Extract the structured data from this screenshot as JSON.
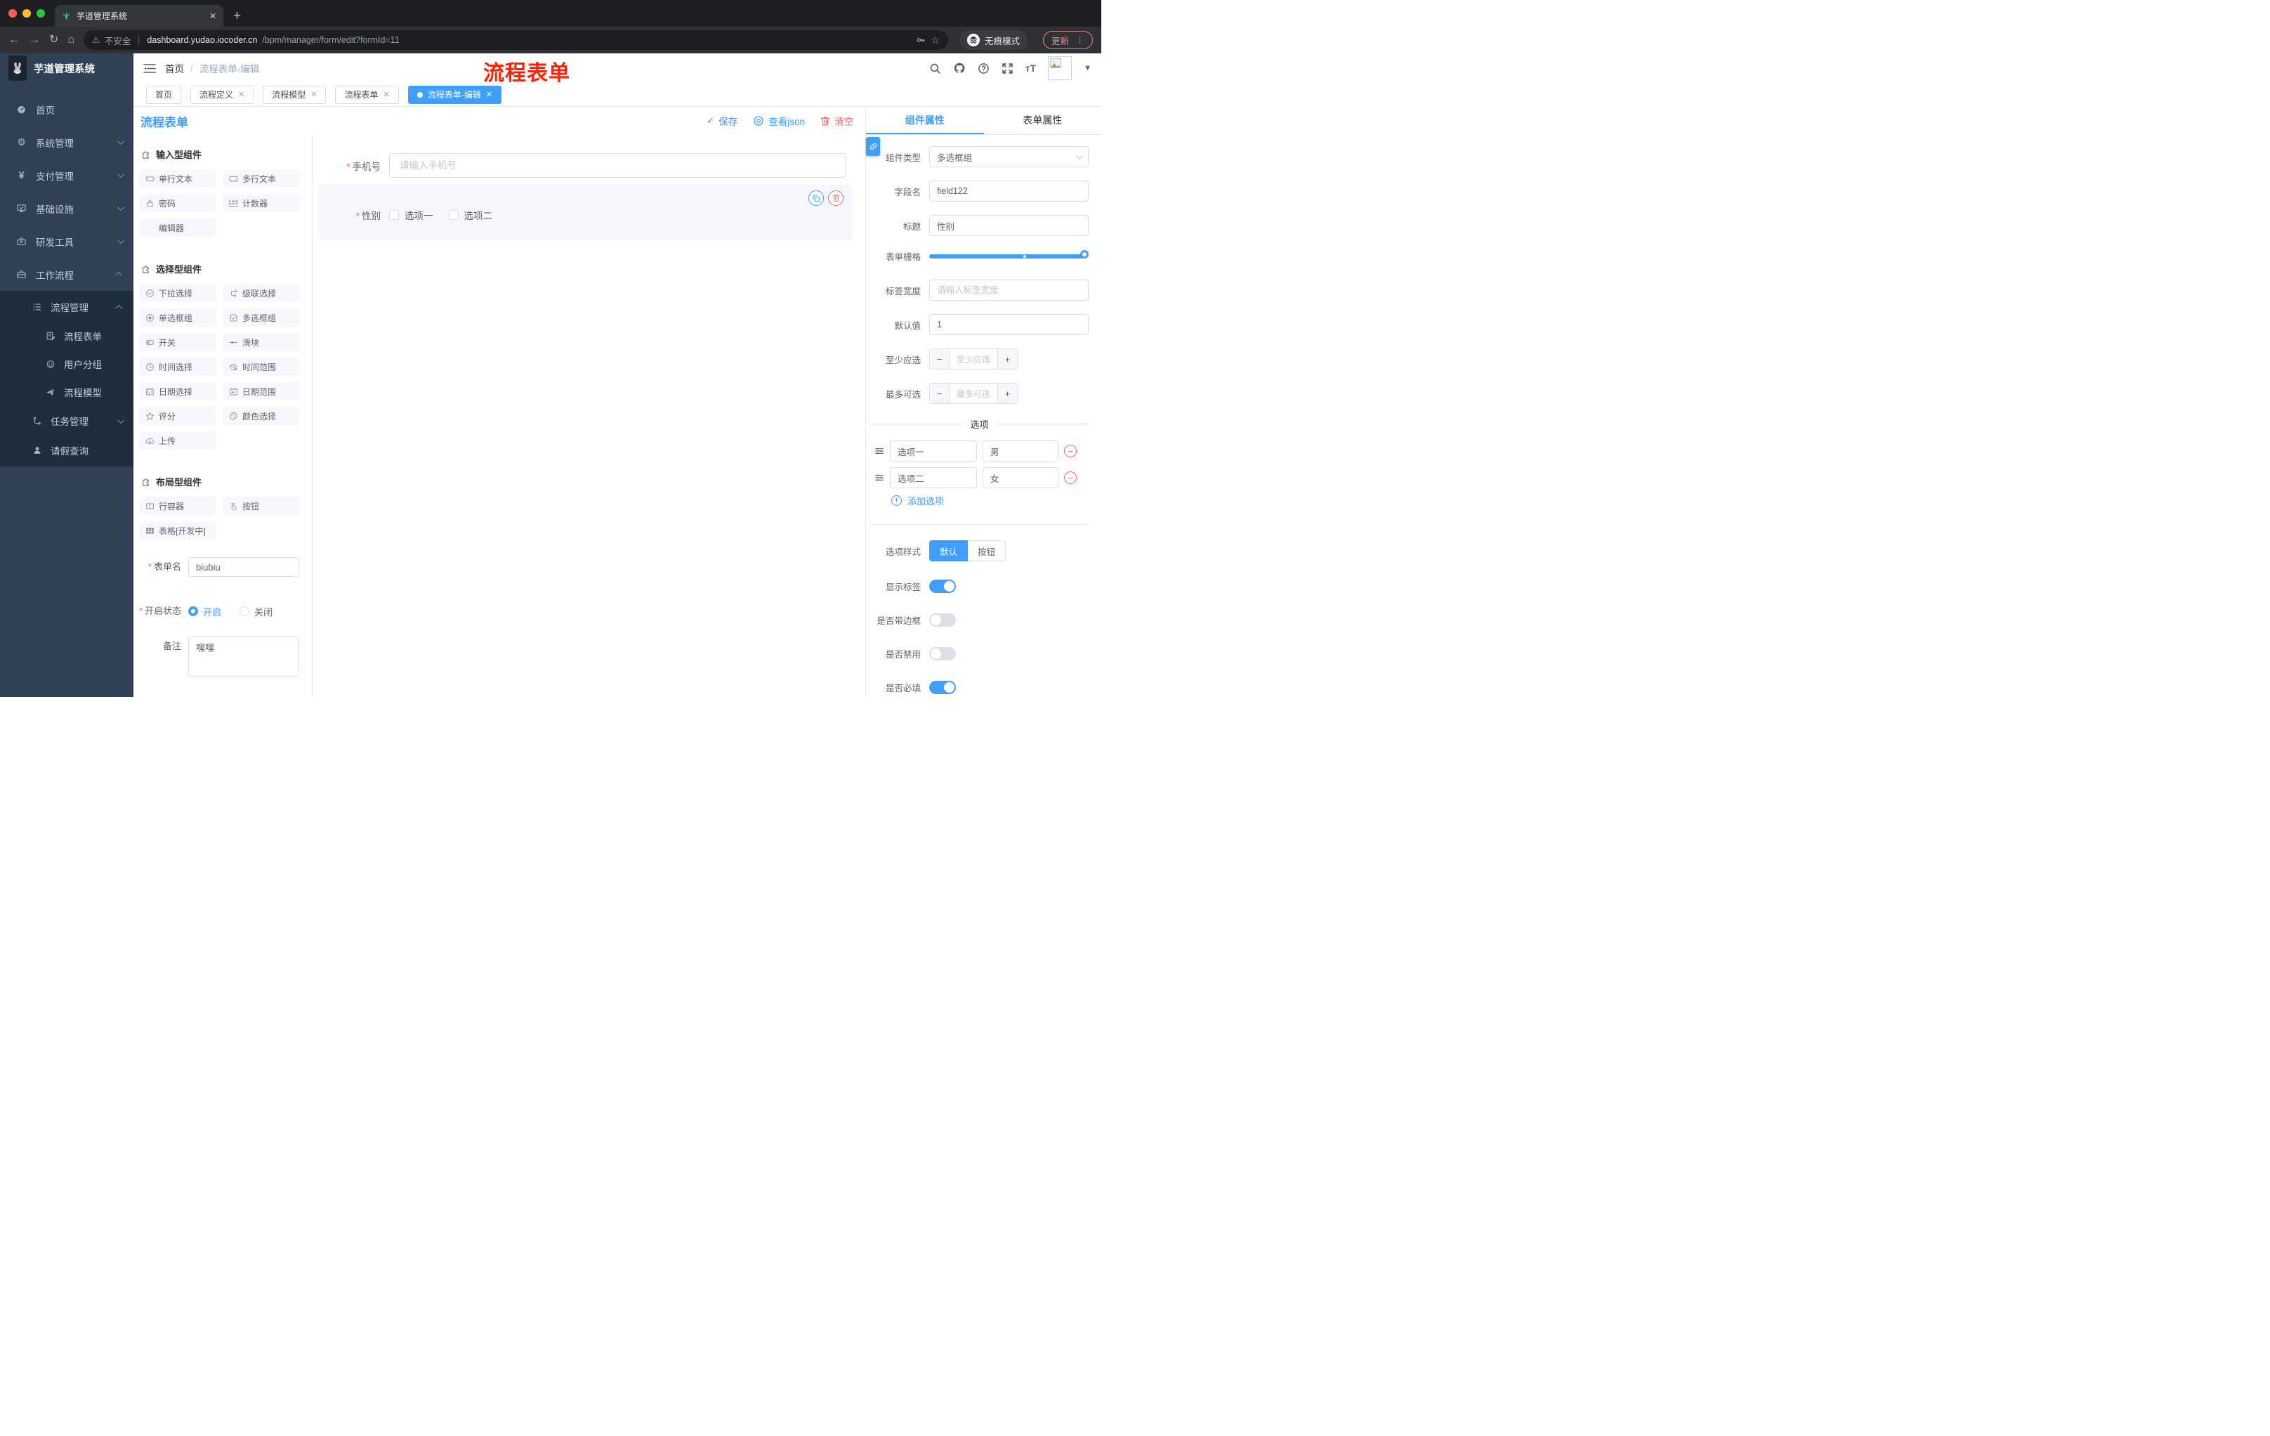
{
  "colors": {
    "primary": "#409EFF",
    "danger": "#F56C6C",
    "watermark_red": "#FF2200",
    "sidebar_bg": "#304156",
    "sidebar_submenu_bg": "#1F2D3D",
    "chrome_dark": "#1E1F22"
  },
  "browser": {
    "tab_title": "芋道管理系统",
    "security": "不安全",
    "domain": "dashboard.yudao.iocoder.cn",
    "path": "/bpm/manager/form/edit?formId=11",
    "incognito": "无痕模式",
    "update": "更新"
  },
  "brand": {
    "title": "芋道管理系统"
  },
  "breadcrumb": {
    "home": "首页",
    "sep": "/",
    "current": "流程表单-编辑"
  },
  "watermark": {
    "text": "流程表单"
  },
  "sidebar": {
    "items": [
      {
        "label": "首页"
      },
      {
        "label": "系统管理"
      },
      {
        "label": "支付管理"
      },
      {
        "label": "基础设施"
      },
      {
        "label": "研发工具"
      },
      {
        "label": "工作流程"
      }
    ],
    "sub": {
      "manage": "流程管理",
      "form": "流程表单",
      "usergroup": "用户分组",
      "model": "流程模型",
      "task": "任务管理",
      "leave": "请假查询"
    }
  },
  "pagetabs": {
    "items": [
      {
        "label": "首页"
      },
      {
        "label": "流程定义"
      },
      {
        "label": "流程模型"
      },
      {
        "label": "流程表单"
      },
      {
        "label": "流程表单-编辑"
      }
    ]
  },
  "area": {
    "title": "流程表单",
    "save": "保存",
    "viewjson": "查看json",
    "clear": "清空"
  },
  "panel": {
    "sections": [
      {
        "title": "输入型组件"
      },
      {
        "title": "选择型组件"
      },
      {
        "title": "布局型组件"
      }
    ],
    "input_items": [
      {
        "label": "单行文本"
      },
      {
        "label": "多行文本"
      },
      {
        "label": "密码"
      },
      {
        "label": "计数器"
      },
      {
        "label": "编辑器"
      }
    ],
    "select_items": [
      {
        "label": "下拉选择"
      },
      {
        "label": "级联选择"
      },
      {
        "label": "单选框组"
      },
      {
        "label": "多选框组"
      },
      {
        "label": "开关"
      },
      {
        "label": "滑块"
      },
      {
        "label": "时间选择"
      },
      {
        "label": "时间范围"
      },
      {
        "label": "日期选择"
      },
      {
        "label": "日期范围"
      },
      {
        "label": "评分"
      },
      {
        "label": "颜色选择"
      },
      {
        "label": "上传"
      }
    ],
    "layout_items": [
      {
        "label": "行容器"
      },
      {
        "label": "按钮"
      },
      {
        "label": "表格[开发中]"
      }
    ]
  },
  "meta": {
    "name_label": "表单名",
    "name_value": "biubiu",
    "status_label": "开启状态",
    "status_on": "开启",
    "status_off": "关闭",
    "remark_label": "备注",
    "remark_value": "嘿嘿"
  },
  "canvas": {
    "phone_label": "手机号",
    "phone_placeholder": "请输入手机号",
    "gender_label": "性别",
    "gender_opt1": "选项一",
    "gender_opt2": "选项二"
  },
  "props": {
    "tab_component": "组件属性",
    "tab_form": "表单属性",
    "type_label": "组件类型",
    "type_value": "多选框组",
    "field_label": "字段名",
    "field_value": "field122",
    "title_label": "标题",
    "title_value": "性别",
    "grid_label": "表单栅格",
    "labelw_label": "标签宽度",
    "labelw_placeholder": "请输入标签宽度",
    "default_label": "默认值",
    "default_value": "1",
    "min_label": "至少应选",
    "min_placeholder": "至少应选",
    "max_label": "最多可选",
    "max_placeholder": "最多可选",
    "options_title": "选项",
    "options": [
      {
        "label": "选项一",
        "value": "男"
      },
      {
        "label": "选项二",
        "value": "女"
      }
    ],
    "add_option": "添加选项",
    "style_label": "选项样式",
    "style_default": "默认",
    "style_button": "按钮",
    "show_label": "显示标签",
    "border_label": "是否带边框",
    "disabled_label": "是否禁用",
    "required_label": "是否必填"
  }
}
